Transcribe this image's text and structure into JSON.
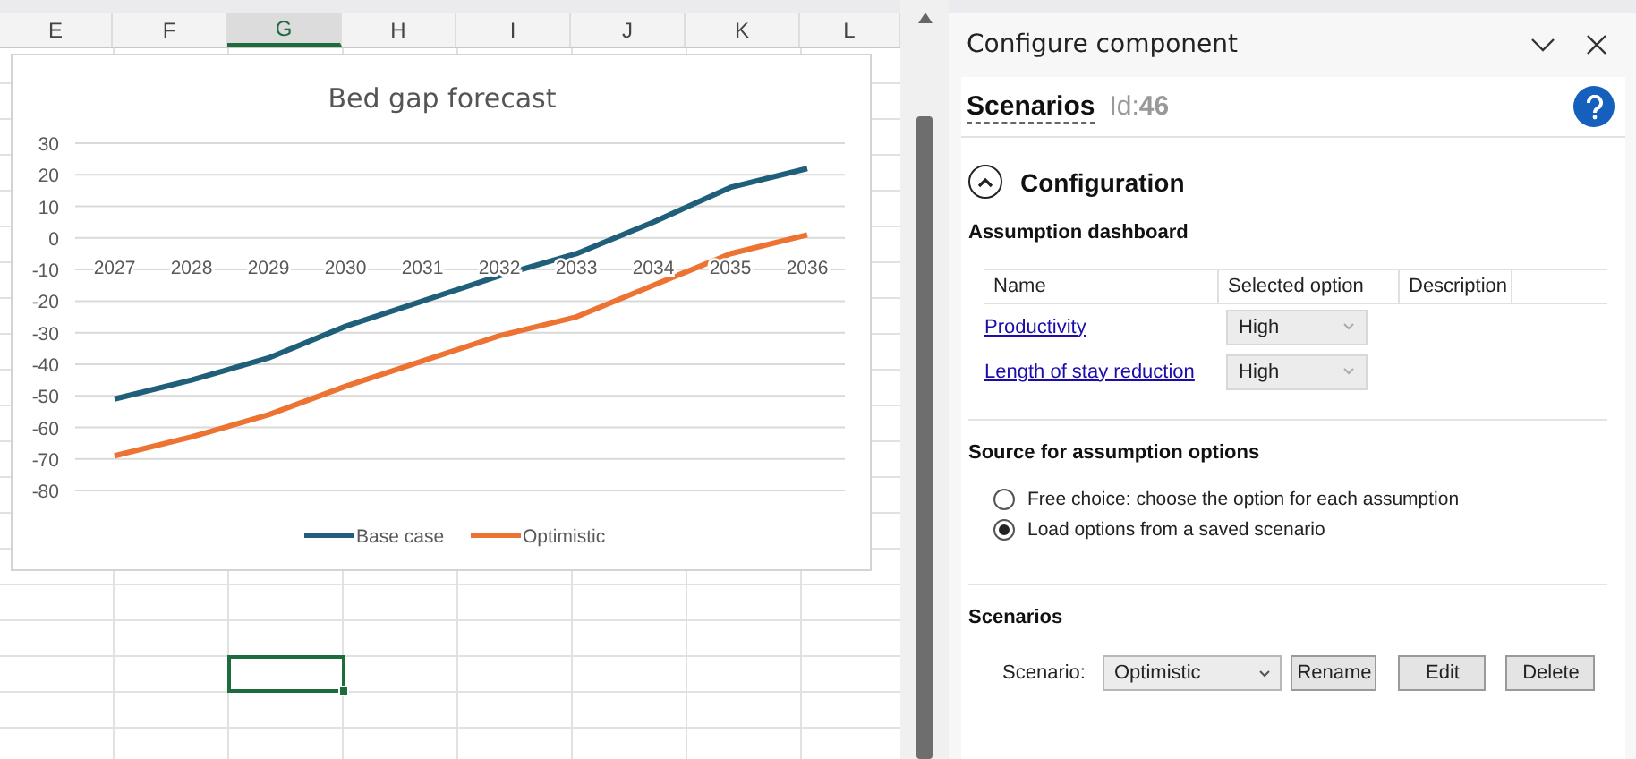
{
  "sheet": {
    "columns": [
      {
        "label": "E",
        "selected": false
      },
      {
        "label": "F",
        "selected": false
      },
      {
        "label": "G",
        "selected": true
      },
      {
        "label": "H",
        "selected": false
      },
      {
        "label": "I",
        "selected": false
      },
      {
        "label": "J",
        "selected": false
      },
      {
        "label": "K",
        "selected": false
      },
      {
        "label": "L",
        "selected": false
      }
    ],
    "chart": {
      "chart_data": {
        "type": "line",
        "title": "Bed gap forecast",
        "grid": true,
        "legend": true,
        "categories": [
          "2027",
          "2028",
          "2029",
          "2030",
          "2031",
          "2032",
          "2033",
          "2034",
          "2035",
          "2036"
        ],
        "ylim": [
          -80,
          30
        ],
        "yticks": [
          30,
          20,
          10,
          0,
          -10,
          -20,
          -30,
          -40,
          -50,
          -60,
          -70,
          -80
        ],
        "series": [
          {
            "name": "Base case",
            "color": "#1f5f7a",
            "values": [
              -51,
              -45,
              -38,
              -28,
              -20,
              -12,
              -5,
              5,
              16,
              22
            ]
          },
          {
            "name": "Optimistic",
            "color": "#ed7332",
            "values": [
              -69,
              -63,
              -56,
              -47,
              -39,
              -31,
              -25,
              -15,
              -5,
              1
            ]
          }
        ]
      }
    }
  },
  "panel": {
    "title": "Configure component",
    "header": {
      "name": "Scenarios",
      "id_label": "Id:",
      "id_value": "46"
    },
    "section": {
      "title": "Configuration",
      "expanded": true
    },
    "dashboard": {
      "title": "Assumption dashboard",
      "columns": [
        "Name",
        "Selected option",
        "Description"
      ],
      "rows": [
        {
          "name": "Productivity",
          "option": "High"
        },
        {
          "name": "Length of stay reduction",
          "option": "High"
        }
      ]
    },
    "source": {
      "title": "Source for assumption options",
      "options": [
        {
          "label": "Free choice: choose the option for each assumption",
          "selected": false
        },
        {
          "label": "Load options from a saved scenario",
          "selected": true
        }
      ]
    },
    "scenarios": {
      "title": "Scenarios",
      "label": "Scenario:",
      "value": "Optimistic",
      "buttons": [
        "Rename",
        "Edit",
        "Delete"
      ]
    }
  }
}
